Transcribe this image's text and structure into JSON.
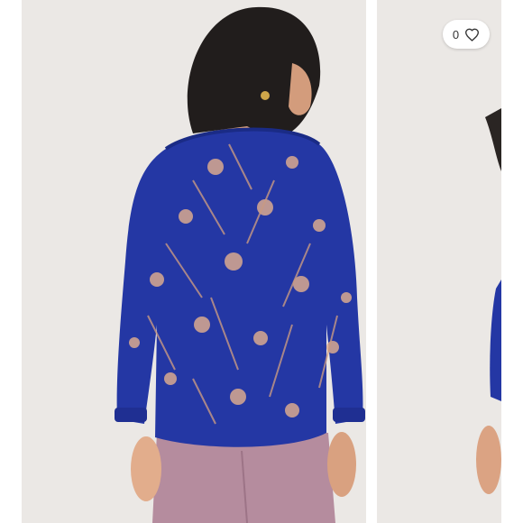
{
  "like_badge": {
    "count": "0",
    "icon": "heart-outline-icon"
  },
  "slides": [
    {
      "subject": "model-back-view-floral-blouse"
    },
    {
      "subject": "model-partial-side-view"
    }
  ],
  "colors": {
    "background": "#e9e6e3",
    "blouse": "#2437a4",
    "heart": "#333333"
  }
}
